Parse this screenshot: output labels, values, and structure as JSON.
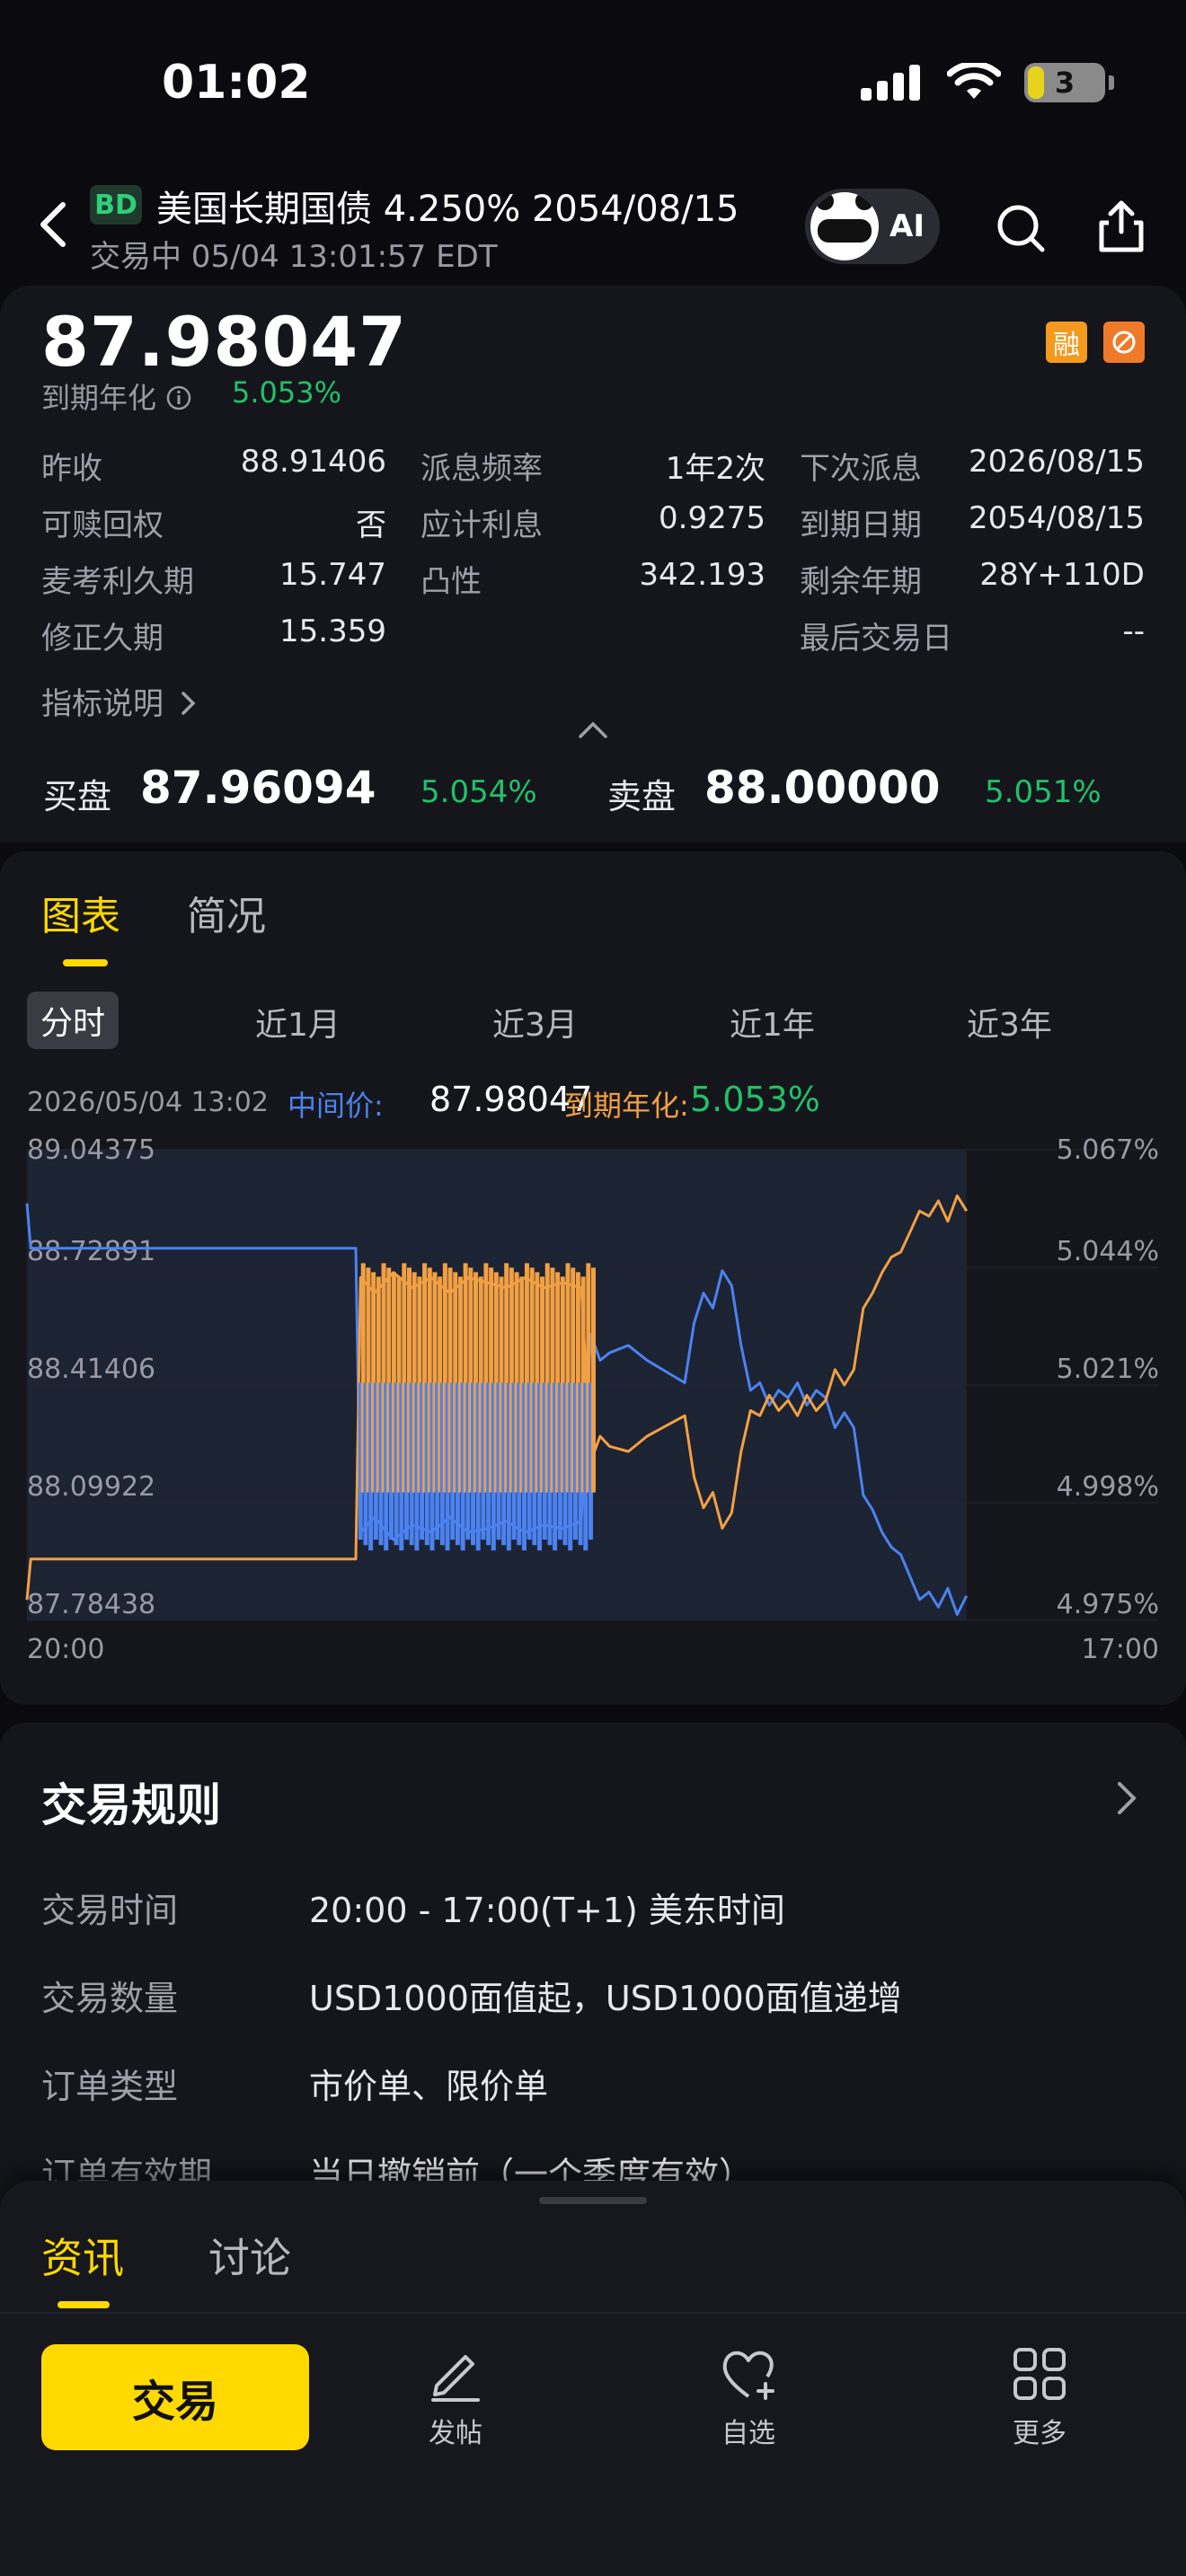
{
  "status_bar": {
    "time": "01:02",
    "battery": "3"
  },
  "header": {
    "badge": "BD",
    "title": "美国长期国债 4.250% 2054/08/15",
    "trade_status": "交易中 05/04 13:01:57 EDT",
    "ai_label": "AI"
  },
  "quote": {
    "price": "87.98047",
    "ytm_label": "到期年化",
    "ytm_value": "5.053%",
    "badge_1": "融",
    "metrics": [
      [
        "昨收",
        "88.91406",
        "派息频率",
        "1年2次",
        "下次派息",
        "2026/08/15"
      ],
      [
        "可赎回权",
        "否",
        "应计利息",
        "0.9275",
        "到期日期",
        "2054/08/15"
      ],
      [
        "麦考利久期",
        "15.747",
        "凸性",
        "342.193",
        "剩余年期",
        "28Y+110D"
      ],
      [
        "修正久期",
        "15.359",
        "",
        "",
        "最后交易日",
        "--"
      ]
    ],
    "metric_link": "指标说明",
    "bid_label": "买盘",
    "bid_price": "87.96094",
    "bid_yield": "5.054%",
    "ask_label": "卖盘",
    "ask_price": "88.00000",
    "ask_yield": "5.051%"
  },
  "chart_tabs": [
    "图表",
    "简况"
  ],
  "range_tabs": [
    "分时",
    "近1月",
    "近3月",
    "近1年",
    "近3年"
  ],
  "chart_info": {
    "date": "2026/05/04 13:02",
    "mid_label": "中间价:",
    "mid_value": "87.98047",
    "ytm_label": "到期年化:",
    "ytm_value": "5.053%"
  },
  "chart_data": {
    "type": "line",
    "x_range": [
      "20:00",
      "17:00"
    ],
    "y_left_ticks": [
      "89.04375",
      "88.72891",
      "88.41406",
      "88.09922",
      "87.78438"
    ],
    "y_right_ticks": [
      "5.067%",
      "5.044%",
      "5.021%",
      "4.998%",
      "4.975%"
    ],
    "y_left_range": [
      87.78438,
      89.04375
    ],
    "y_right_range": [
      4.975,
      5.067
    ],
    "series": [
      {
        "name": "中间价",
        "color": "#4c82f0",
        "x": [
          0,
          0.004,
          0.35,
          0.355,
          0.37,
          0.39,
          0.41,
          0.43,
          0.45,
          0.47,
          0.49,
          0.51,
          0.53,
          0.55,
          0.57,
          0.59,
          0.6,
          0.61,
          0.62,
          0.64,
          0.66,
          0.68,
          0.7,
          0.71,
          0.72,
          0.73,
          0.74,
          0.75,
          0.76,
          0.77,
          0.78,
          0.79,
          0.8,
          0.81,
          0.82,
          0.83,
          0.84,
          0.85,
          0.86,
          0.87,
          0.88,
          0.89,
          0.9,
          0.91,
          0.92,
          0.93,
          0.94,
          0.95,
          0.96,
          0.97,
          0.98,
          0.99,
          1.0
        ],
        "values": [
          88.9,
          88.78,
          88.78,
          88.02,
          88.06,
          88.0,
          88.04,
          88.02,
          88.06,
          88.02,
          88.03,
          88.05,
          88.02,
          88.04,
          88.03,
          88.05,
          88.55,
          88.48,
          88.5,
          88.52,
          88.48,
          88.45,
          88.42,
          88.58,
          88.66,
          88.62,
          88.72,
          88.68,
          88.52,
          88.4,
          88.42,
          88.36,
          88.4,
          88.38,
          88.42,
          88.36,
          88.4,
          88.38,
          88.3,
          88.34,
          88.3,
          88.12,
          88.08,
          88.02,
          87.98,
          87.96,
          87.9,
          87.84,
          87.86,
          87.82,
          87.87,
          87.8,
          87.85
        ]
      },
      {
        "name": "到期年化",
        "color": "#f2a043",
        "x": [
          0,
          0.004,
          0.35,
          0.355,
          0.37,
          0.39,
          0.41,
          0.43,
          0.45,
          0.47,
          0.49,
          0.51,
          0.53,
          0.55,
          0.57,
          0.59,
          0.6,
          0.61,
          0.62,
          0.64,
          0.66,
          0.68,
          0.7,
          0.71,
          0.72,
          0.73,
          0.74,
          0.75,
          0.76,
          0.77,
          0.78,
          0.79,
          0.8,
          0.81,
          0.82,
          0.83,
          0.84,
          0.85,
          0.86,
          0.87,
          0.88,
          0.89,
          0.9,
          0.91,
          0.92,
          0.93,
          0.94,
          0.95,
          0.96,
          0.97,
          0.98,
          0.99,
          1.0
        ],
        "values": [
          4.979,
          4.987,
          4.987,
          5.042,
          5.039,
          5.043,
          5.04,
          5.042,
          5.039,
          5.042,
          5.041,
          5.04,
          5.042,
          5.04,
          5.041,
          5.04,
          5.006,
          5.011,
          5.009,
          5.008,
          5.011,
          5.013,
          5.015,
          5.003,
          4.997,
          5.0,
          4.993,
          4.996,
          5.008,
          5.016,
          5.015,
          5.019,
          5.016,
          5.018,
          5.015,
          5.019,
          5.016,
          5.018,
          5.024,
          5.021,
          5.024,
          5.036,
          5.039,
          5.043,
          5.046,
          5.047,
          5.051,
          5.055,
          5.054,
          5.057,
          5.053,
          5.058,
          5.055
        ]
      }
    ]
  },
  "rules": {
    "title": "交易规则",
    "items": [
      {
        "label": "交易时间",
        "value": "20:00 - 17:00(T+1) 美东时间"
      },
      {
        "label": "交易数量",
        "value": "USD1000面值起，USD1000面值递增"
      },
      {
        "label": "订单类型",
        "value": "市价单、限价单"
      },
      {
        "label": "订单有效期",
        "value": "当日撤销前（一个季度有效）"
      }
    ]
  },
  "bottom_sheet": {
    "tabs": [
      "资讯",
      "讨论"
    ]
  },
  "bottom_nav": {
    "trade": "交易",
    "post": "发帖",
    "watchlist": "自选",
    "more": "更多"
  },
  "colors": {
    "accent": "#ffd900",
    "up": "#22c06a",
    "mid_line": "#4c82f0",
    "ytm_line": "#f2a043"
  }
}
